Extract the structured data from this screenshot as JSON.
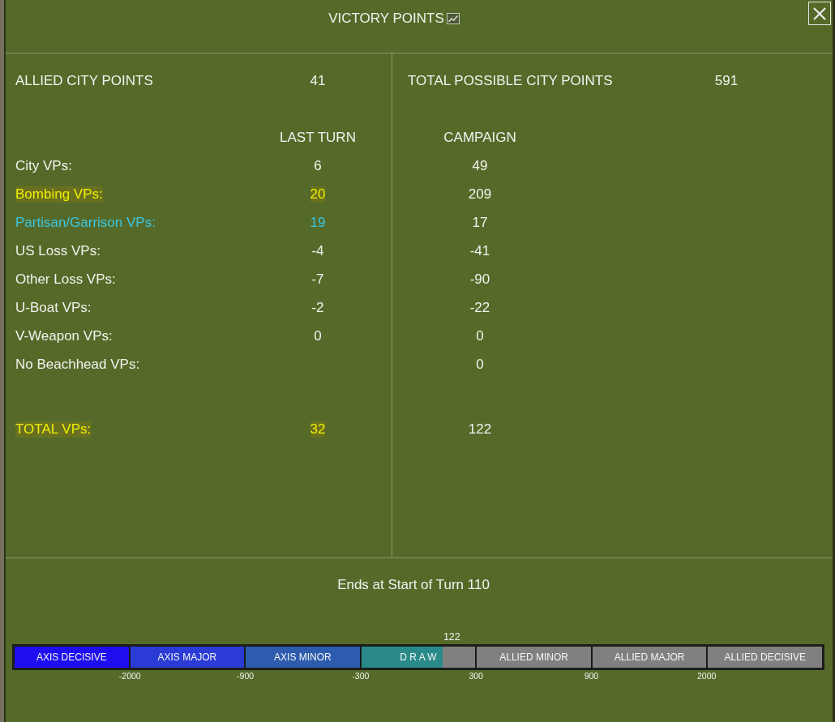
{
  "window": {
    "title": "VICTORY POINTS"
  },
  "city_points": [
    {
      "label": "ALLIED CITY POINTS",
      "value": "41"
    },
    {
      "label": "TOTAL POSSIBLE CITY POINTS",
      "value": "591"
    }
  ],
  "columns": [
    "LAST TURN",
    "CAMPAIGN"
  ],
  "rows": [
    {
      "label": "City VPs:",
      "last_turn": "6",
      "campaign": "49",
      "color": "#f2f2ee",
      "highlighted": false
    },
    {
      "label": "Bombing VPs:",
      "last_turn": "20",
      "campaign": "209",
      "color": "#eeee00",
      "highlighted": true
    },
    {
      "label": "Partisan/Garrison VPs:",
      "last_turn": "19",
      "campaign": "17",
      "color": "#3cc6e2",
      "highlighted": false
    },
    {
      "label": "US Loss VPs:",
      "last_turn": "-4",
      "campaign": "-41",
      "color": "#f2f2ee",
      "highlighted": false
    },
    {
      "label": "Other Loss VPs:",
      "last_turn": "-7",
      "campaign": "-90",
      "color": "#f2f2ee",
      "highlighted": false
    },
    {
      "label": "U-Boat VPs:",
      "last_turn": "-2",
      "campaign": "-22",
      "color": "#f2f2ee",
      "highlighted": false
    },
    {
      "label": "V-Weapon VPs:",
      "last_turn": "0",
      "campaign": "0",
      "color": "#f2f2ee",
      "highlighted": false
    },
    {
      "label": "No Beachhead VPs:",
      "campaign": "0",
      "color": "#f2f2ee",
      "highlighted": false
    }
  ],
  "total": {
    "label": "TOTAL VPs:",
    "last_turn": "32",
    "campaign": "122",
    "color": "#eeee00",
    "highlighted": true
  },
  "end_note": "Ends at Start of Turn 110",
  "scale": {
    "marker": "122",
    "level": 0.53,
    "segments": [
      {
        "label": "AXIS DECISIVE",
        "color": "#1e0ef0"
      },
      {
        "label": "AXIS MAJOR",
        "color": "#2a3bd6"
      },
      {
        "label": "AXIS MINOR",
        "color": "#2d5cae"
      },
      {
        "label": "D R A W",
        "color": "#2a8a8a"
      },
      {
        "label": "ALLIED MINOR"
      },
      {
        "label": "ALLIED MAJOR"
      },
      {
        "label": "ALLIED DECISIVE"
      }
    ],
    "ticks": [
      "-2000",
      "-900",
      "-300",
      "300",
      "900",
      "2000"
    ]
  }
}
